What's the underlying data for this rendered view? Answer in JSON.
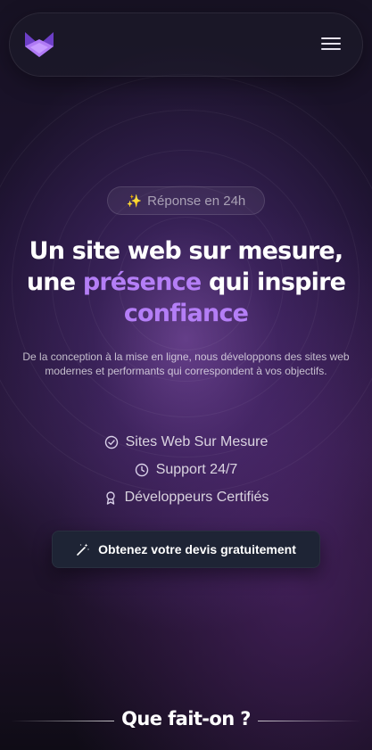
{
  "header": {
    "logo_icon": "fox-logo-icon",
    "menu_icon": "hamburger-menu-icon"
  },
  "hero": {
    "badge": {
      "icon": "sparkles-icon",
      "text": "Réponse en 24h"
    },
    "headline": {
      "line1": "Un site web sur mesure,",
      "line2_prefix": "une ",
      "line2_accent": "présence",
      "line2_suffix": " qui inspire",
      "line3_accent": "confiance"
    },
    "subtext": "De la conception à la mise en ligne, nous développons des sites web modernes et performants qui correspondent à vos objectifs.",
    "features": [
      {
        "icon": "check-circle-icon",
        "label": "Sites Web Sur Mesure"
      },
      {
        "icon": "clock-icon",
        "label": "Support 24/7"
      },
      {
        "icon": "award-icon",
        "label": "Développeurs Certifiés"
      }
    ],
    "cta": {
      "icon": "magic-wand-icon",
      "label": "Obtenez votre devis gratuitement"
    }
  },
  "section": {
    "title": "Que fait-on ?"
  },
  "colors": {
    "accent": "#b47ef6",
    "logo_purple": "#9a5cf2",
    "cta_background": "#1e2435",
    "background_dark": "#171223"
  }
}
